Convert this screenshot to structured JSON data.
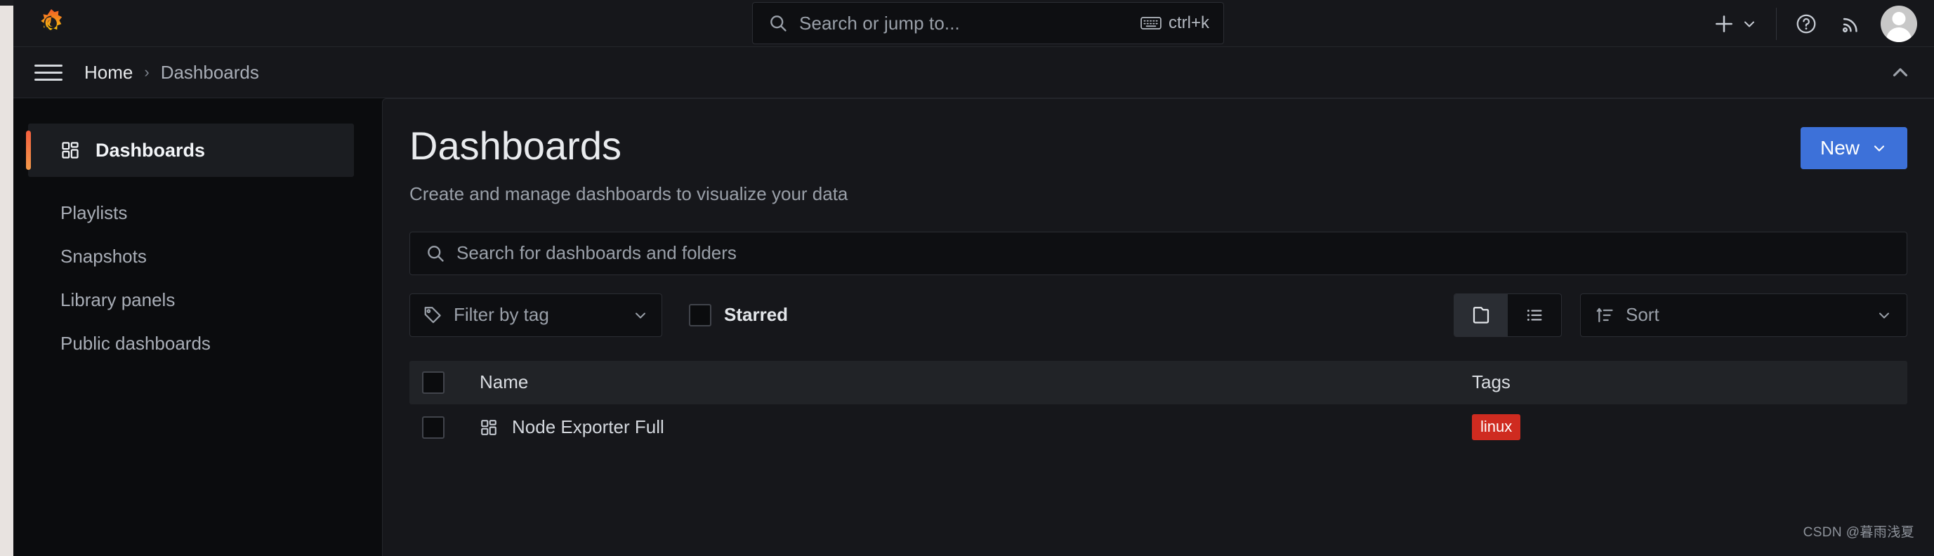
{
  "topnav": {
    "logo_icon": "grafana-logo-icon",
    "search": {
      "placeholder": "Search or jump to...",
      "shortcut": "ctrl+k",
      "search_icon": "search-icon",
      "keyboard_icon": "keyboard-icon"
    },
    "add_label": "",
    "icons": {
      "plus": "plus-icon",
      "chevron": "chevron-down-icon",
      "help": "help-circle-icon",
      "news": "rss-icon",
      "avatar": "user-avatar"
    }
  },
  "breadcrumb": {
    "menu_icon": "hamburger-menu-icon",
    "home": "Home",
    "separator": "›",
    "current": "Dashboards",
    "collapse_icon": "chevron-up-icon"
  },
  "sidebar": {
    "active": {
      "label": "Dashboards",
      "icon": "apps-grid-icon"
    },
    "items": [
      {
        "label": "Playlists"
      },
      {
        "label": "Snapshots"
      },
      {
        "label": "Library panels"
      },
      {
        "label": "Public dashboards"
      }
    ]
  },
  "main": {
    "title": "Dashboards",
    "subtitle": "Create and manage dashboards to visualize your data",
    "new_button": {
      "label": "New",
      "chevron_icon": "chevron-down-icon"
    },
    "search": {
      "placeholder": "Search for dashboards and folders",
      "value": "",
      "icon": "search-icon"
    },
    "filters": {
      "tag_filter": {
        "label": "Filter by tag",
        "icon": "tag-icon",
        "chevron_icon": "chevron-down-icon"
      },
      "starred": {
        "label": "Starred",
        "checked": false
      },
      "view_toggle": {
        "folder_view": "folder-icon",
        "list_view": "list-icon",
        "active": "folder_view"
      },
      "sort": {
        "label": "Sort",
        "icon": "sort-amount-up-icon",
        "chevron_icon": "chevron-down-icon"
      }
    },
    "table": {
      "columns": {
        "name": "Name",
        "tags": "Tags"
      },
      "rows": [
        {
          "name": "Node Exporter Full",
          "icon": "apps-grid-icon",
          "tags": [
            "linux"
          ],
          "checked": false
        }
      ]
    }
  },
  "watermark": "CSDN @暮雨浅夏",
  "colors": {
    "accent_orange": "#f55f3e",
    "primary_blue": "#3d71d9",
    "tag_red": "#cf2b20",
    "bg_dark": "#0b0c0e",
    "bg_panel": "#16171b"
  }
}
